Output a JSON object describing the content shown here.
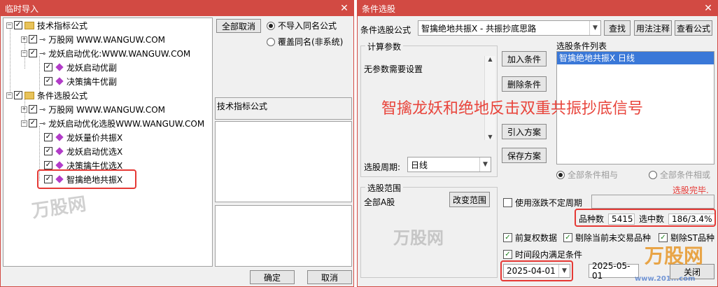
{
  "left": {
    "title": "临时导入",
    "tree": [
      {
        "label": "技术指标公式"
      },
      {
        "label": "万股网 WWW.WANGUW.COM"
      },
      {
        "label": "龙妖启动优化:WWW.WANGUW.COM"
      },
      {
        "label": "龙妖启动优副"
      },
      {
        "label": "决策擒牛优副"
      },
      {
        "label": "条件选股公式"
      },
      {
        "label": "万股网 WWW.WANGUW.COM"
      },
      {
        "label": "龙妖启动优化选股WWW.WANGUW.COM"
      },
      {
        "label": "龙妖量价共振X"
      },
      {
        "label": "龙妖启动优选X"
      },
      {
        "label": "决策擒牛优选X"
      },
      {
        "label": "智擒绝地共振X"
      }
    ],
    "cancel_all": "全部取消",
    "radio_skip": "不导入同名公式",
    "radio_overwrite": "覆盖同名(非系统)",
    "info_label": "技术指标公式",
    "ok": "确定",
    "cancel": "取消"
  },
  "right": {
    "title": "条件选股",
    "formula_label": "条件选股公式",
    "formula_value": "智擒绝地共振X  - 共振抄底思路",
    "btn_find": "查找",
    "btn_usage": "用法注释",
    "btn_view": "查看公式",
    "calc_params": "计算参数",
    "no_params": "无参数需要设置",
    "btn_add": "加入条件",
    "btn_delete": "删除条件",
    "btn_import": "引入方案",
    "btn_save": "保存方案",
    "cond_list_label": "选股条件列表",
    "cond_item": "智擒绝地共振X  日线",
    "overlay_text": "智擒龙妖和绝地反击双重共振抄底信号",
    "period_label": "选股周期:",
    "period_value": "日线",
    "radio_and": "全部条件相与",
    "radio_or": "全部条件相或",
    "done": "选股完毕.",
    "range_group": "选股范围",
    "range_value": "全部A股",
    "btn_change_range": "改变范围",
    "chk_variable_period": "使用涨跌不定周期",
    "count_label": "品种数",
    "count_value": "5415",
    "selected_label": "选中数",
    "selected_value": "186/3.4%",
    "chk_forward": "前复权数据",
    "chk_remove_untraded": "剔除当前未交易品种",
    "chk_remove_st": "剔除ST品种",
    "chk_time_range": "时间段内满足条件",
    "date_from": "2025-04-01",
    "date_to": "2025-05-01",
    "btn_close": "关闭",
    "watermark_brand": "万股网",
    "watermark_url": "www.201...com"
  }
}
